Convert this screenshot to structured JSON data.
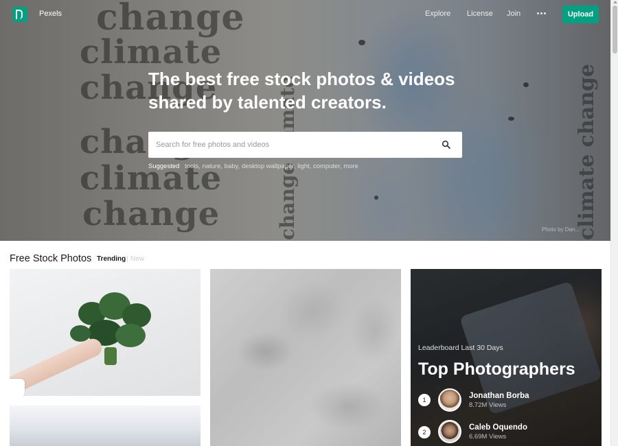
{
  "nav": {
    "brand": "Pexels",
    "links": [
      "Explore",
      "License",
      "Join"
    ],
    "more_icon": "ellipsis-icon",
    "upload_label": "Upload"
  },
  "hero": {
    "headline_line1": "The best free stock photos & videos",
    "headline_line2": "shared by talented creators.",
    "search_placeholder": "Search for free photos and videos",
    "search_icon": "search-icon",
    "suggested_label": "Suggested",
    "suggested_tags": [
      "tools",
      "nature",
      "baby",
      "desktop wallpaper",
      "light",
      "computer",
      "more"
    ],
    "background_words": [
      "change",
      "climate",
      "change",
      "change",
      "climate",
      "change"
    ],
    "photo_credit": "Photo by Dan..."
  },
  "section": {
    "title": "Free Stock Photos",
    "tab_trending": "Trending",
    "tab_separator": "|",
    "tab_new": "New"
  },
  "leaderboard": {
    "subtitle": "Leaderboard Last 30 Days",
    "title": "Top Photographers",
    "photographers": [
      {
        "rank": "1",
        "name": "Jonathan Borba",
        "views": "8.72M Views"
      },
      {
        "rank": "2",
        "name": "Caleb Oquendo",
        "views": "6.69M Views"
      }
    ]
  },
  "colors": {
    "accent": "#05a081"
  }
}
